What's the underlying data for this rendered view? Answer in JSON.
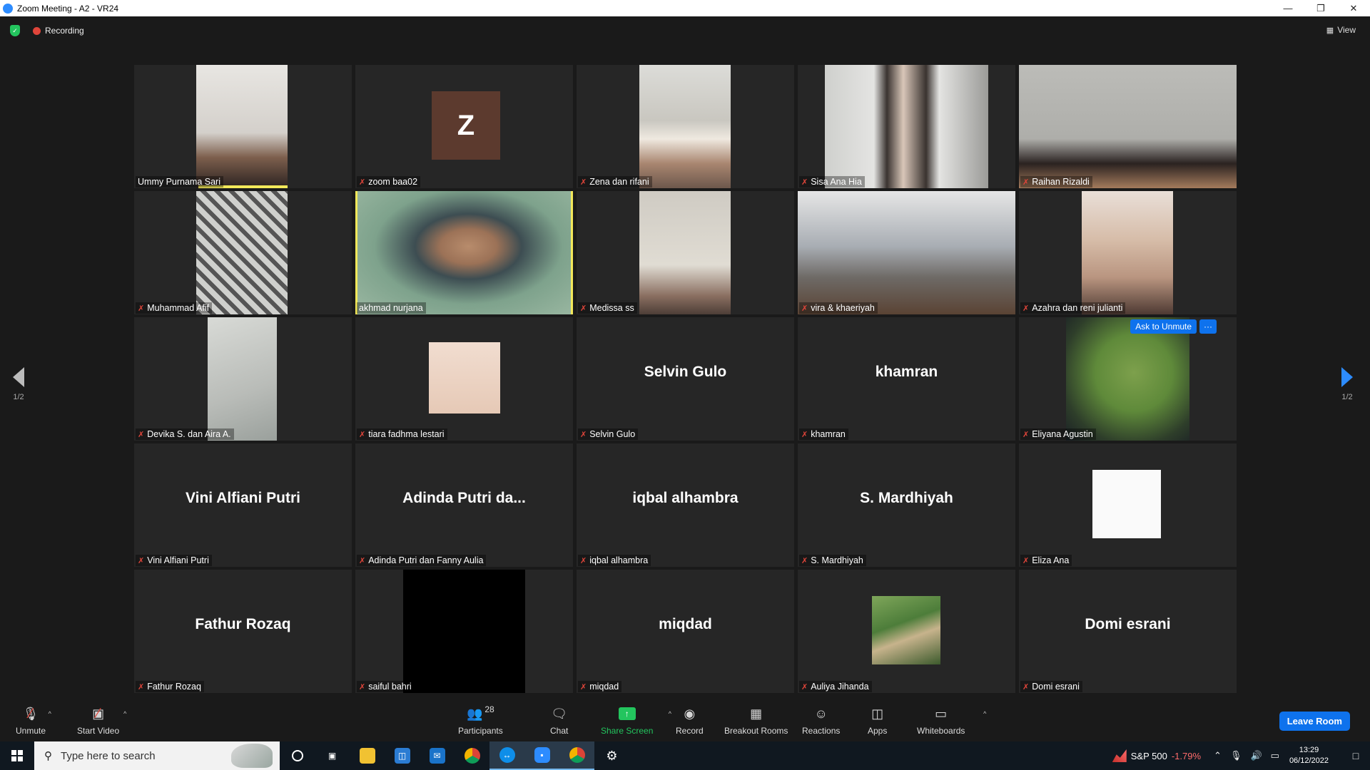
{
  "window": {
    "title": "Zoom Meeting - A2 - VR24"
  },
  "topbar": {
    "recording_label": "Recording",
    "view_label": "View"
  },
  "pager": {
    "left": "1/2",
    "right": "1/2"
  },
  "popup": {
    "ask_unmute": "Ask to Unmute",
    "more": "···"
  },
  "avatar_letter": "Z",
  "tiles": [
    {
      "name": "Ummy Purnama Sari",
      "muted": false,
      "display": "video"
    },
    {
      "name": "zoom baa02",
      "muted": true,
      "display": "avatar"
    },
    {
      "name": "Zena dan rifani",
      "muted": true,
      "display": "video"
    },
    {
      "name": "Sisa Ana Hia",
      "muted": true,
      "display": "video"
    },
    {
      "name": "Raihan Rizaldi",
      "muted": true,
      "display": "video"
    },
    {
      "name": "Muhammad Afif",
      "muted": true,
      "display": "video"
    },
    {
      "name": "akhmad nurjana",
      "muted": false,
      "display": "video",
      "active_speaker": true
    },
    {
      "name": "Medissa ss",
      "muted": true,
      "display": "video"
    },
    {
      "name": "vira & khaeriyah",
      "muted": true,
      "display": "video"
    },
    {
      "name": "Azahra dan reni julianti",
      "muted": true,
      "display": "video"
    },
    {
      "name": "Devika S. dan Aira A.",
      "muted": true,
      "display": "video"
    },
    {
      "name": "tiara fadhma lestari",
      "muted": true,
      "display": "photo"
    },
    {
      "name": "Selvin Gulo",
      "muted": true,
      "display": "name",
      "big_name": "Selvin Gulo"
    },
    {
      "name": "khamran",
      "muted": true,
      "display": "name",
      "big_name": "khamran"
    },
    {
      "name": "Eliyana Agustin",
      "muted": true,
      "display": "video"
    },
    {
      "name": "Vini Alfiani Putri",
      "muted": true,
      "display": "name",
      "big_name": "Vini Alfiani Putri"
    },
    {
      "name": "Adinda Putri dan Fanny Aulia",
      "muted": true,
      "display": "name",
      "big_name": "Adinda Putri da..."
    },
    {
      "name": "iqbal alhambra",
      "muted": true,
      "display": "name",
      "big_name": "iqbal alhambra"
    },
    {
      "name": "S. Mardhiyah",
      "muted": true,
      "display": "name",
      "big_name": "S. Mardhiyah"
    },
    {
      "name": "Eliza Ana",
      "muted": true,
      "display": "photo"
    },
    {
      "name": "Fathur Rozaq",
      "muted": true,
      "display": "name",
      "big_name": "Fathur Rozaq"
    },
    {
      "name": "saiful bahri",
      "muted": true,
      "display": "video"
    },
    {
      "name": "miqdad",
      "muted": true,
      "display": "name",
      "big_name": "miqdad"
    },
    {
      "name": "Auliya Jihanda",
      "muted": true,
      "display": "photo"
    },
    {
      "name": "Domi esrani",
      "muted": true,
      "display": "name",
      "big_name": "Domi esrani"
    }
  ],
  "toolbar": {
    "unmute": "Unmute",
    "start_video": "Start Video",
    "participants": "Participants",
    "participants_count": "28",
    "chat": "Chat",
    "share_screen": "Share Screen",
    "record": "Record",
    "breakout_rooms": "Breakout Rooms",
    "reactions": "Reactions",
    "apps": "Apps",
    "whiteboards": "Whiteboards",
    "leave_room": "Leave Room"
  },
  "taskbar": {
    "search_placeholder": "Type here to search",
    "stock_name": "S&P 500",
    "stock_change": "-1.79%",
    "time": "13:29",
    "date": "06/12/2022"
  },
  "colors": {
    "accent_blue": "#0e72ed",
    "share_green": "#23c55e",
    "muted_red": "#e0453a",
    "active_speaker": "#f3e85a"
  }
}
